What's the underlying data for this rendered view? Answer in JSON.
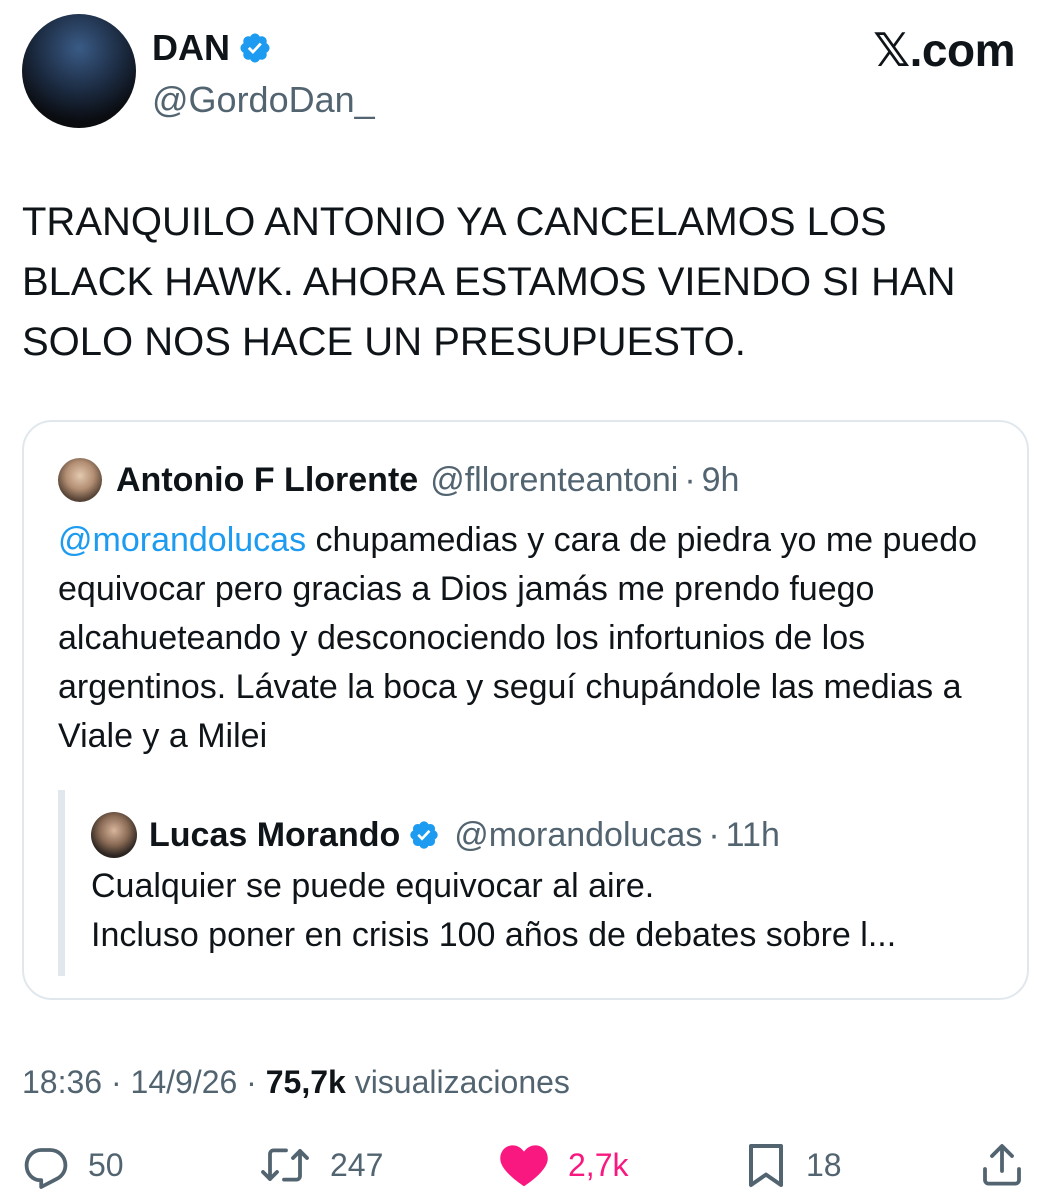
{
  "header": {
    "author_name": "DAN",
    "author_handle": "@GordoDan_",
    "brand": "𝕏.com",
    "verified_icon": "verified-badge-icon"
  },
  "tweet": {
    "text": "TRANQUILO ANTONIO YA CANCELAMOS LOS\nBLACK HAWK. AHORA ESTAMOS VIENDO SI HAN\nSOLO NOS HACE UN PRESUPUESTO."
  },
  "quote": {
    "author_name": "Antonio F Llorente",
    "author_handle": "@fllorenteantoni",
    "time": "9h",
    "mention": "@morandolucas",
    "text": " chupamedias y cara de piedra yo me puedo equivocar pero gracias a Dios jamás me prendo fuego alcahueteando y desconociendo los infortunios de los argentinos. Lávate la boca y seguí chupándole las medias a Viale y a Milei",
    "nested": {
      "author_name": "Lucas Morando",
      "author_handle": "@morandolucas",
      "time": "11h",
      "line1": "Cualquier se puede equivocar al aire.",
      "line2": "Incluso poner en crisis 100 años de debates sobre l..."
    }
  },
  "meta": {
    "time": "18:36",
    "date": "14/9/26",
    "views": "75,7k",
    "views_label": "visualizaciones",
    "separator": "·"
  },
  "actions": {
    "replies": "50",
    "reposts": "247",
    "likes": "2,7k",
    "bookmarks": "18"
  },
  "colors": {
    "text": "#0f1419",
    "muted": "#536471",
    "link": "#1d9bf0",
    "like": "#f91880",
    "verified": "#1d9bf0",
    "border": "#e1e8ed"
  }
}
